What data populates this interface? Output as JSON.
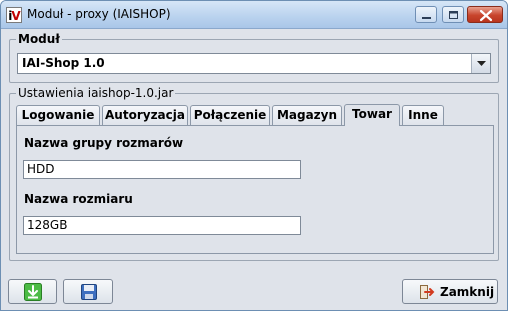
{
  "window": {
    "icon_text_i": "i",
    "icon_text_v": "V",
    "title": "Moduł - proxy (IAISHOP)"
  },
  "module_group": {
    "legend": "Moduł",
    "selected": "IAI-Shop 1.0"
  },
  "settings_group": {
    "legend": "Ustawienia iaishop-1.0.jar",
    "tabs": [
      {
        "label": "Logowanie"
      },
      {
        "label": "Autoryzacja"
      },
      {
        "label": "Połączenie"
      },
      {
        "label": "Magazyn"
      },
      {
        "label": "Towar"
      },
      {
        "label": "Inne"
      }
    ],
    "active_tab": "Towar"
  },
  "fields": {
    "size_group_label": "Nazwa grupy rozmarów",
    "size_group_value": "HDD",
    "size_name_label": "Nazwa rozmiaru",
    "size_name_value": "128GB"
  },
  "buttons": {
    "close_label": "Zamknij"
  },
  "icons": {
    "import": "download-arrow-icon",
    "save": "floppy-disk-icon",
    "close": "exit-door-icon"
  },
  "colors": {
    "import_icon": "#39a834",
    "save_icon": "#2f5fa8",
    "close_icon": "#d23a1f"
  }
}
